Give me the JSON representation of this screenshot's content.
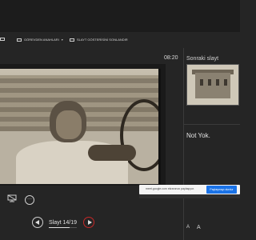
{
  "toolbar": {
    "item1_label": "",
    "item2_label": "GÖREVDEN ANAHLARI",
    "item3_label": "SLAYT GÖSTERİSİNİ SONLANDIR"
  },
  "timer": "08:20",
  "sidebar": {
    "next_slide_label": "Sonraki slayt",
    "notes_text": "Not Yok."
  },
  "notification": {
    "text": "meet.google.com ekranınızı paylaşıyor.",
    "button_label": "Paylaşmayı durdur"
  },
  "navigation": {
    "slide_counter": "Slayt 14/19",
    "progress_fraction": 0.737
  },
  "text_size": {
    "decrease_label": "A",
    "increase_label": "A"
  },
  "colors": {
    "background": "#252525",
    "accent_blue": "#1a73e8",
    "next_button_ring": "#c62828"
  }
}
